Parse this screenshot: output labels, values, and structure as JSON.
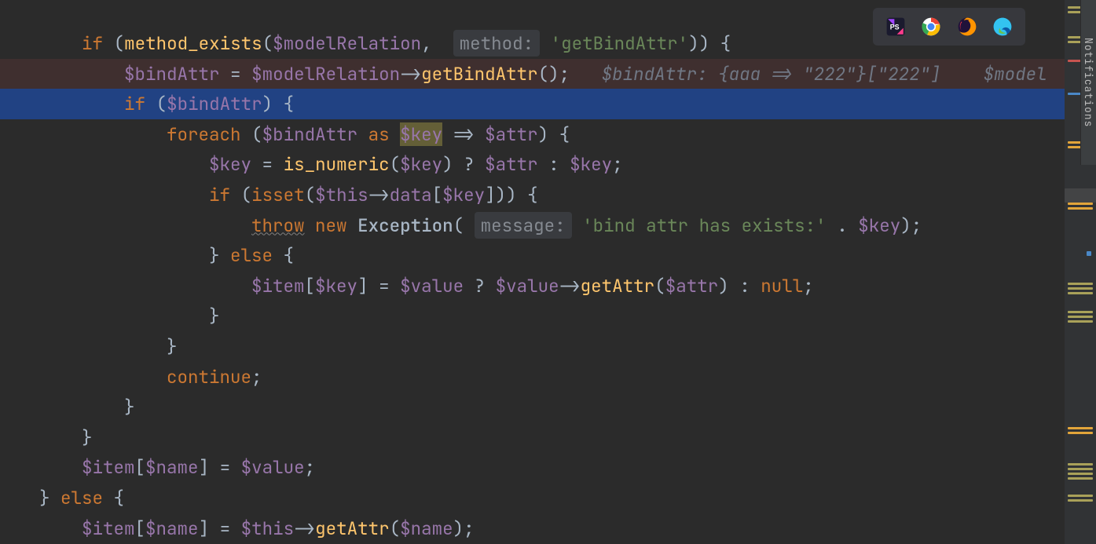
{
  "code": {
    "if_kw": "if",
    "method_exists_fn": "method_exists",
    "var_modelRelation": "$modelRelation",
    "hint_method": "method:",
    "str_getBindAttr": "'getBindAttr'",
    "var_bindAttr": "$bindAttr",
    "assign_getBindAttr_fn": "getBindAttr",
    "inlay_bindAttr": "$bindAttr: {aaa => \"222\"}[\"222\"]",
    "inlay_trail": "$model",
    "foreach_kw": "foreach",
    "as_kw": "as",
    "var_key": "$key",
    "var_attr": "$attr",
    "is_numeric_fn": "is_numeric",
    "isset_kw": "isset",
    "this_kw": "$this",
    "data_prop": "data",
    "throw_kw": "throw",
    "new_kw": "new",
    "exception_cls": "Exception",
    "hint_message": "message:",
    "str_bindexists": "'bind attr has exists:'",
    "else_kw": "else",
    "var_item": "$item",
    "var_value": "$value",
    "getAttr_fn": "getAttr",
    "null_kw": "null",
    "continue_kw": "continue",
    "var_name": "$name"
  },
  "toolbar": {
    "icons": [
      "phpstorm",
      "chrome",
      "firefox",
      "edge"
    ]
  },
  "notif_label": "Notifications"
}
